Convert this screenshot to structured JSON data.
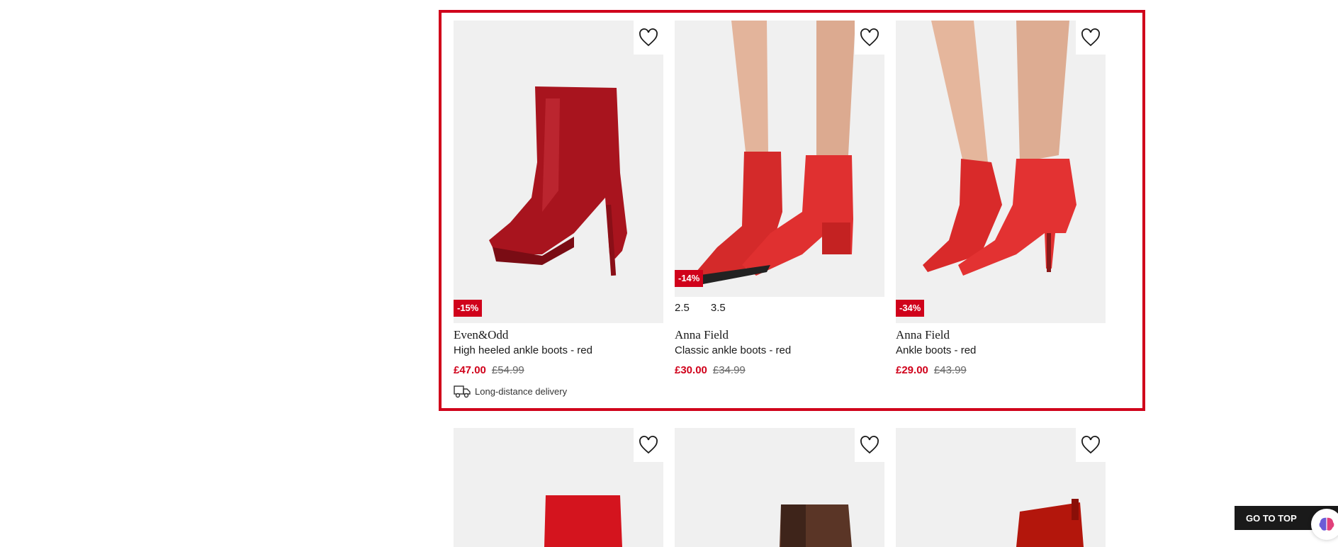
{
  "products_row1": [
    {
      "brand": "Even&Odd",
      "name": "High heeled ankle boots - red",
      "badge": "-15%",
      "price_now": "£47.00",
      "price_old": "£54.99",
      "delivery": "Long-distance delivery",
      "image": "red patent stiletto ankle boot"
    },
    {
      "brand": "Anna Field",
      "name": "Classic ankle boots - red",
      "badge": "-14%",
      "sizes": [
        "2.5",
        "3.5"
      ],
      "price_now": "£30.00",
      "price_old": "£34.99",
      "image": "red suede block heel ankle boots on model"
    },
    {
      "brand": "Anna Field",
      "name": "Ankle boots - red",
      "badge": "-34%",
      "price_now": "£29.00",
      "price_old": "£43.99",
      "image": "red suede stiletto ankle boots on model"
    }
  ],
  "products_row2": [
    {
      "image": "red ankle boot"
    },
    {
      "image": "brown ankle boot"
    },
    {
      "image": "red chelsea boot"
    }
  ],
  "wishlist_icon": "heart-icon",
  "go_to_top": "GO TO TOP",
  "colors": {
    "accent": "#d0021b",
    "image_bg": "#f0f0f0"
  }
}
